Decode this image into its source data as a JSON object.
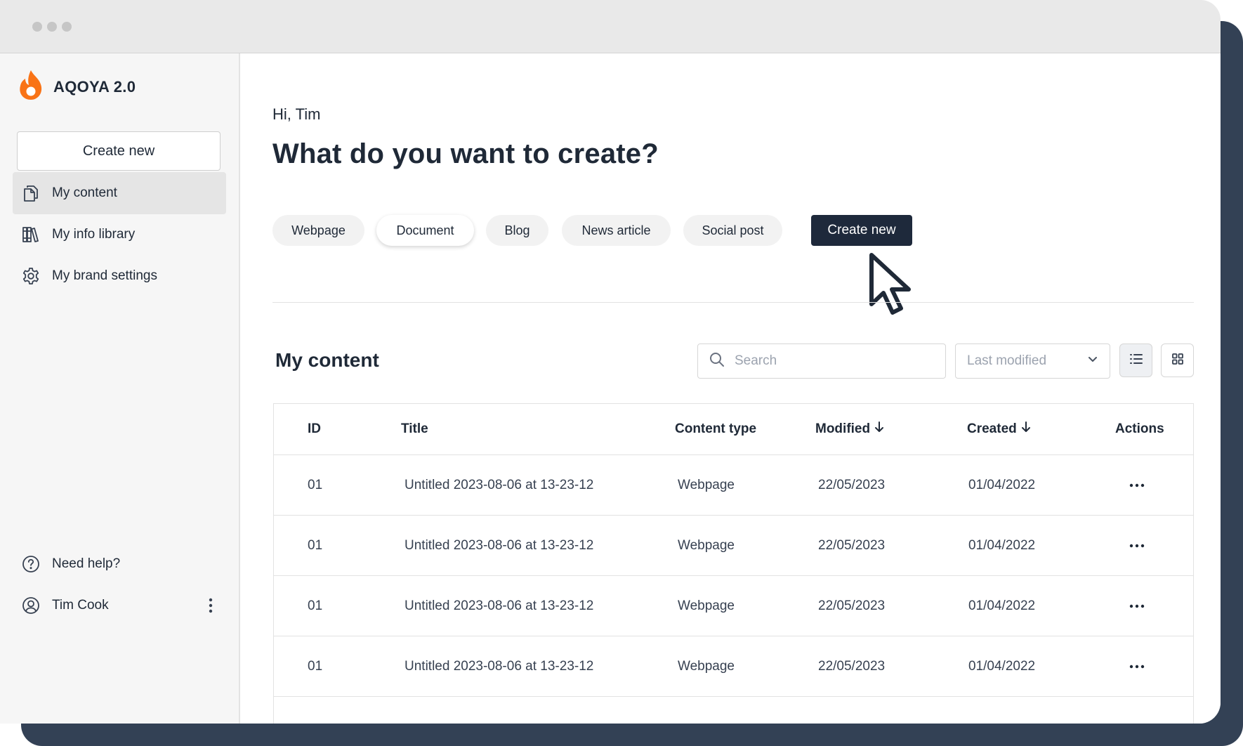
{
  "brand": {
    "name": "AQOYA 2.0",
    "logo_icon": "flame-icon",
    "accent": "#f97316"
  },
  "sidebar": {
    "create_label": "Create new",
    "nav": [
      {
        "label": "My content",
        "icon": "documents-icon",
        "active": true
      },
      {
        "label": "My info library",
        "icon": "library-icon",
        "active": false
      },
      {
        "label": "My brand settings",
        "icon": "gear-icon",
        "active": false
      }
    ],
    "help_label": "Need help?",
    "user_name": "Tim Cook"
  },
  "main": {
    "greeting": "Hi, Tim",
    "headline": "What do you want to create?",
    "content_types": [
      "Webpage",
      "Document",
      "Blog",
      "News article",
      "Social post"
    ],
    "selected_type": "Document",
    "create_button": "Create new",
    "primary_color": "#1e293b"
  },
  "content": {
    "title": "My content",
    "search_placeholder": "Search",
    "sort_value": "Last modified",
    "columns": [
      "ID",
      "Title",
      "Content type",
      "Modified",
      "Created",
      "Actions"
    ],
    "rows": [
      {
        "id": "01",
        "title": "Untitled 2023-08-06 at 13-23-12",
        "type": "Webpage",
        "modified": "22/05/2023",
        "created": "01/04/2022"
      },
      {
        "id": "01",
        "title": "Untitled 2023-08-06 at 13-23-12",
        "type": "Webpage",
        "modified": "22/05/2023",
        "created": "01/04/2022"
      },
      {
        "id": "01",
        "title": "Untitled 2023-08-06 at 13-23-12",
        "type": "Webpage",
        "modified": "22/05/2023",
        "created": "01/04/2022"
      },
      {
        "id": "01",
        "title": "Untitled 2023-08-06 at 13-23-12",
        "type": "Webpage",
        "modified": "22/05/2023",
        "created": "01/04/2022"
      }
    ]
  }
}
